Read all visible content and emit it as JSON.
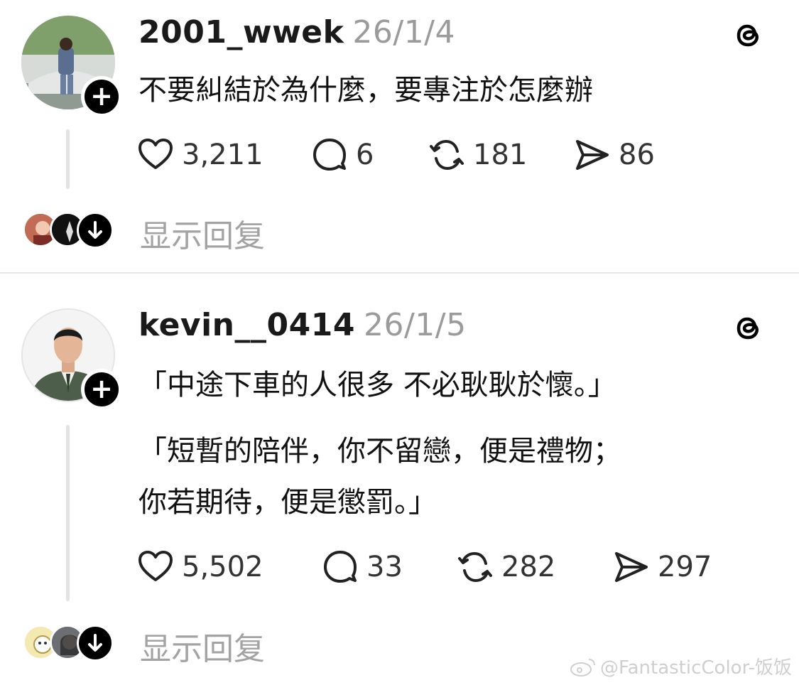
{
  "posts": [
    {
      "username": "2001_wwek",
      "date": "26/1/4",
      "text": "不要糾結於為什麼，要專注於怎麼辦",
      "stats": {
        "likes": "3,211",
        "comments": "6",
        "reposts": "181",
        "shares": "86"
      },
      "show_replies": "显示回复"
    },
    {
      "username": "kevin__0414",
      "date": "26/1/5",
      "text_lines": [
        "「中途下車的人很多 不必耿耿於懷。」",
        "「短暫的陪伴，你不留戀，便是禮物；",
        "你若期待，便是懲罰。」"
      ],
      "stats": {
        "likes": "5,502",
        "comments": "33",
        "reposts": "282",
        "shares": "297"
      },
      "show_replies": "显示回复"
    }
  ],
  "icons": {
    "follow": "plus-icon",
    "like": "heart-icon",
    "comment": "comment-icon",
    "repost": "repost-icon",
    "share": "share-icon",
    "app": "threads-logo-icon",
    "more_replies": "arrow-down-icon"
  },
  "watermark": "@FantasticColor-饭饭"
}
